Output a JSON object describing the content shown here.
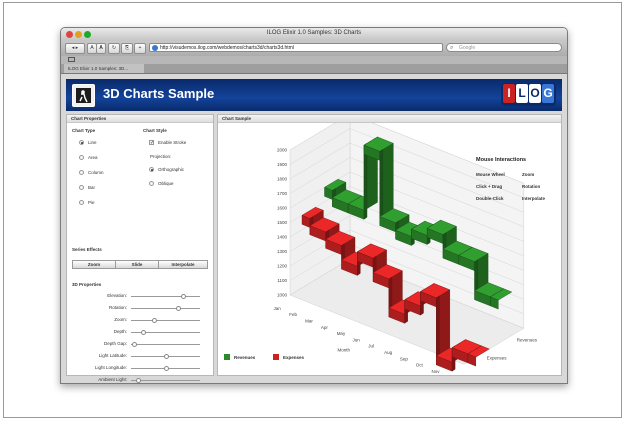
{
  "window": {
    "title": "ILOG Elixir 1.0 Samples: 3D Charts"
  },
  "toolbar": {
    "back_label": "◂ ▸",
    "text_small_label": "A",
    "text_large_label": "A",
    "reload_label": "↻",
    "snap_label": "⎘",
    "add_label": "+",
    "url": "http://visudemos.ilog.com/webdemos/charts3d/charts3d.html",
    "search_placeholder": "Google"
  },
  "tab": {
    "label": "ILOG Elixir 1.0 Samples: 3D..."
  },
  "banner": {
    "title": "3D Charts Sample",
    "logo_letters": [
      "I",
      "L",
      "O",
      "G"
    ]
  },
  "left_panel": {
    "header": "Chart Properties",
    "chart_type": {
      "heading": "Chart Type",
      "options": [
        "Line",
        "Area",
        "Column",
        "Bar",
        "Pie"
      ],
      "selected": "Line"
    },
    "chart_style": {
      "heading": "Chart Style",
      "enable_stroke": "Enable Stroke",
      "projection_label": "Projection:",
      "projections": [
        "Orthographic",
        "Oblique"
      ],
      "selected_projection": "Orthographic"
    },
    "series_effects": {
      "heading": "Series Effects",
      "buttons": [
        "Zoom",
        "Slide",
        "Interpolate"
      ]
    },
    "properties_3d": {
      "heading": "3D Properties",
      "sliders": [
        {
          "label": "Elevation:",
          "value": 0.75
        },
        {
          "label": "Rotation:",
          "value": 0.68
        },
        {
          "label": "Zoom:",
          "value": 0.32
        },
        {
          "label": "Depth:",
          "value": 0.15
        },
        {
          "label": "Depth Gap:",
          "value": 0.02
        },
        {
          "label": "Light Latitude:",
          "value": 0.5
        },
        {
          "label": "Light Longitude:",
          "value": 0.5
        },
        {
          "label": "Ambient Light:",
          "value": 0.08
        }
      ]
    }
  },
  "right_panel": {
    "header": "Chart Sample",
    "mouse": {
      "title": "Mouse Interactions",
      "rows": [
        {
          "action": "Mouse Wheel",
          "effect": "Zoom"
        },
        {
          "action": "Click + Drag",
          "effect": "Rotation"
        },
        {
          "action": "Double-Click",
          "effect": "Interpolate"
        }
      ]
    }
  },
  "chart_data": {
    "type": "line",
    "x": [
      "Jan",
      "Feb",
      "Mar",
      "Apr",
      "May",
      "Jun",
      "Jul",
      "Aug",
      "Sep",
      "Oct",
      "Nov",
      "Dec"
    ],
    "x_title": "Month",
    "series": [
      {
        "name": "Revenues",
        "color": "#2a8a2a",
        "values": [
          1600,
          1550,
          1550,
          2000,
          1550,
          1500,
          1550,
          1600,
          1500,
          1500,
          1300,
          1300
        ]
      },
      {
        "name": "Expenses",
        "color": "#cc2222",
        "values": [
          1500,
          1450,
          1400,
          1300,
          1400,
          1300,
          1100,
          1200,
          1300,
          900,
          1000,
          1000
        ]
      }
    ],
    "depth_labels": [
      "Revenues",
      "Expenses"
    ],
    "yticks": [
      1000,
      1100,
      1200,
      1300,
      1400,
      1500,
      1600,
      1700,
      1800,
      1900,
      2000
    ],
    "ylim": [
      1000,
      2000
    ],
    "grid": true,
    "legend": "bottom-left"
  }
}
